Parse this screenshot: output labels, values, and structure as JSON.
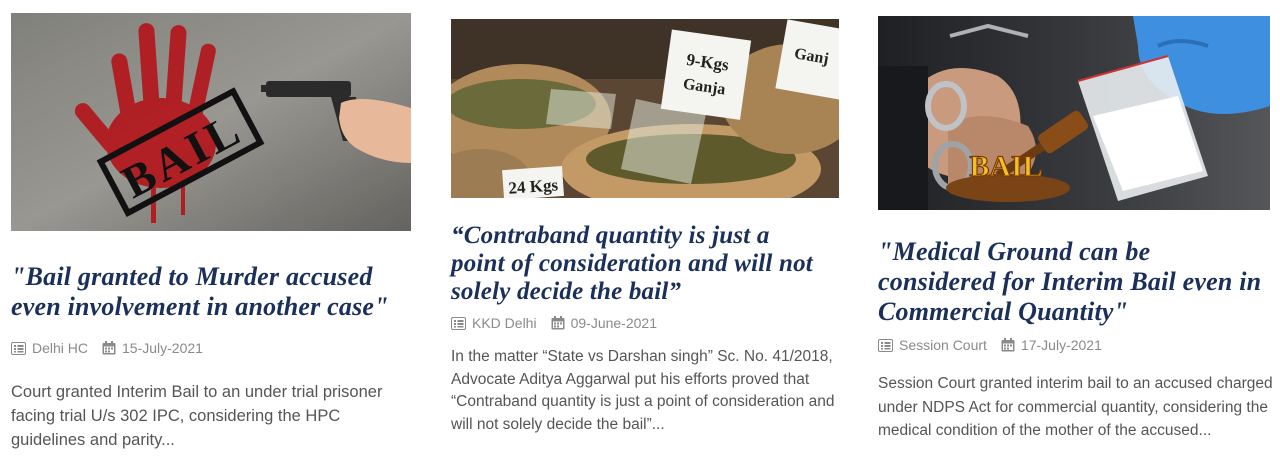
{
  "cards": [
    {
      "title": "\"Bail granted to Murder accused even involvement in another case\"",
      "image_label": "BAIL",
      "category": "Delhi HC",
      "category_icon": "list-icon",
      "date": "15-July-2021",
      "date_icon": "calendar-icon",
      "excerpt": "Court granted Interim Bail to an under trial prisoner facing trial U/s 302 IPC, considering the HPC guidelines and parity..."
    },
    {
      "title": "“Contraband quantity is just a point of consideration and will not solely decide the bail”",
      "image_labels": [
        "9-Kgs",
        "Ganja",
        "24 Kgs",
        "Ganj"
      ],
      "category": "KKD Delhi",
      "category_icon": "list-icon",
      "date": "09-June-2021",
      "date_icon": "calendar-icon",
      "excerpt": "In the matter “State vs Darshan singh” Sc. No. 41/2018, Advocate Aditya Aggarwal put his efforts proved that “Contraband quantity is just a point of consideration and will not solely decide the bail”..."
    },
    {
      "title": "\"Medical Ground can be considered for Interim Bail even in Commercial Quantity\"",
      "image_label": "BAIL",
      "category": "Session Court",
      "category_icon": "list-icon",
      "date": "17-July-2021",
      "date_icon": "calendar-icon",
      "excerpt": "Session Court granted interim bail to an accused charged under NDPS Act for commercial quantity, considering the medical condition of the mother of the accused..."
    }
  ],
  "colors": {
    "title": "#1a2f5a",
    "meta": "#8a8a8a",
    "excerpt": "#555555"
  }
}
